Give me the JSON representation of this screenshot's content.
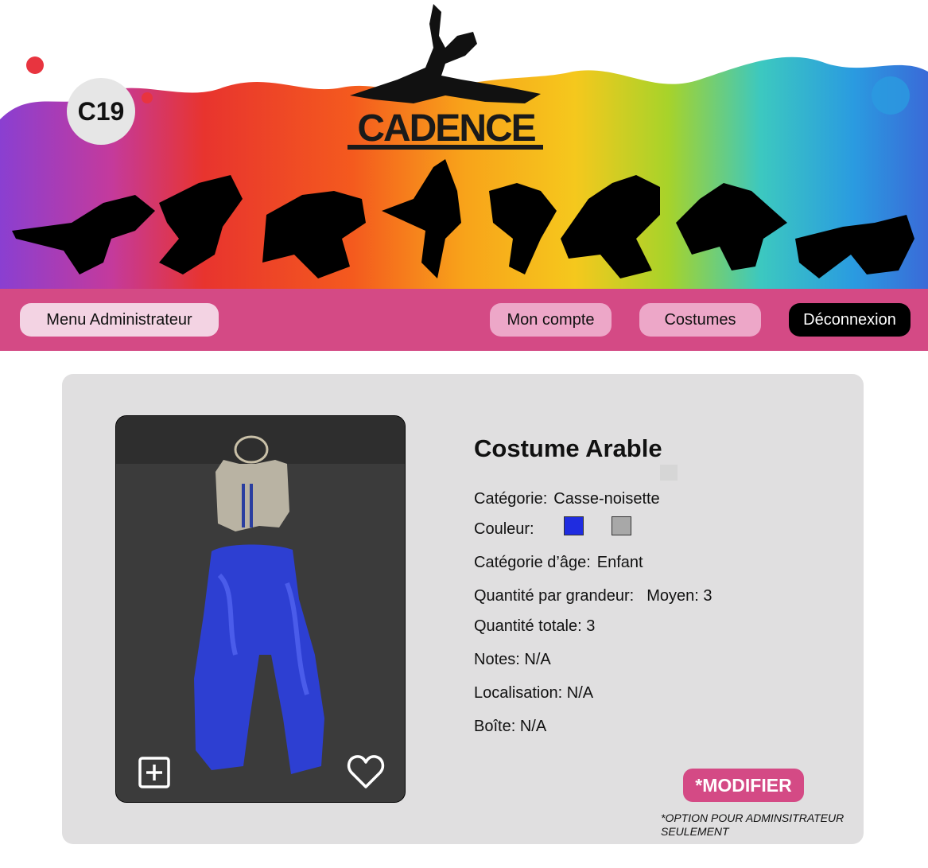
{
  "banner": {
    "avatar_text": "C19",
    "logo_text": "CADENCE"
  },
  "nav": {
    "admin_menu": "Menu Administrateur",
    "my_account": "Mon compte",
    "costumes": "Costumes",
    "logout": "Déconnexion"
  },
  "costume": {
    "title": "Costume Arable",
    "category_label": "Catégorie:",
    "category_value": "Casse-noisette",
    "color_label": "Couleur:",
    "colors": [
      "#1f2ce0",
      "#a8a8a8"
    ],
    "age_label": "Catégorie d’âge:",
    "age_value": "Enfant",
    "size_qty_label": "Quantité par grandeur:",
    "size_qty_value": "Moyen: 3",
    "total_qty_label": "Quantité totale:",
    "total_qty_value": "3",
    "notes_label": "Notes:",
    "notes_value": "N/A",
    "location_label": "Localisation:",
    "location_value": "N/A",
    "box_label": "Boîte:",
    "box_value": "N/A"
  },
  "actions": {
    "modify": "*MODIFIER",
    "admin_note": "*OPTION POUR ADMINSITRATEUR SEULEMENT"
  },
  "icons": {
    "add": "plus-square-icon",
    "favorite": "heart-icon"
  }
}
